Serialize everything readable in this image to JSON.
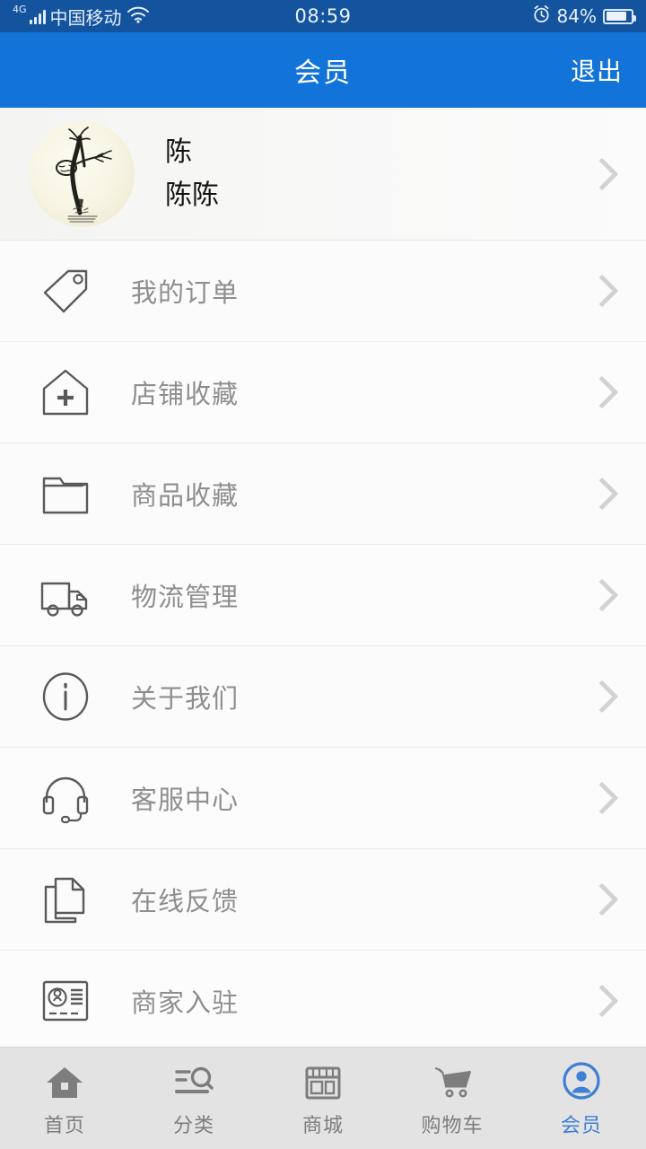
{
  "statusbar": {
    "network_type": "4G",
    "carrier": "中国移动",
    "wifi_icon": "wifi-icon",
    "time": "08:59",
    "alarm_icon": "alarm-clock-icon",
    "battery_percent": "84%",
    "battery_icon": "battery-icon"
  },
  "header": {
    "title": "会员",
    "action_label": "退出"
  },
  "profile": {
    "avatar_icon": "user-avatar-ink-painting",
    "name": "陈",
    "nickname": "陈陈",
    "chevron_icon": "chevron-right-icon"
  },
  "menu": {
    "items": [
      {
        "label": "我的订单",
        "icon": "price-tag-icon",
        "chevron": "chevron-right-icon"
      },
      {
        "label": "店铺收藏",
        "icon": "house-plus-icon",
        "chevron": "chevron-right-icon"
      },
      {
        "label": "商品收藏",
        "icon": "folder-icon",
        "chevron": "chevron-right-icon"
      },
      {
        "label": "物流管理",
        "icon": "truck-icon",
        "chevron": "chevron-right-icon"
      },
      {
        "label": "关于我们",
        "icon": "info-circle-icon",
        "chevron": "chevron-right-icon"
      },
      {
        "label": "客服中心",
        "icon": "headset-icon",
        "chevron": "chevron-right-icon"
      },
      {
        "label": "在线反馈",
        "icon": "documents-icon",
        "chevron": "chevron-right-icon"
      },
      {
        "label": "商家入驻",
        "icon": "id-card-icon",
        "chevron": "chevron-right-icon"
      }
    ]
  },
  "tabbar": {
    "items": [
      {
        "label": "首页",
        "icon": "home-icon",
        "active": false
      },
      {
        "label": "分类",
        "icon": "category-search-icon",
        "active": false
      },
      {
        "label": "商城",
        "icon": "storefront-icon",
        "active": false
      },
      {
        "label": "购物车",
        "icon": "shopping-cart-icon",
        "active": false
      },
      {
        "label": "会员",
        "icon": "user-circle-icon",
        "active": true
      }
    ]
  },
  "colors": {
    "statusbar_bg": "#14549f",
    "header_bg": "#1273d8",
    "accent": "#3f7fd4",
    "icon_gray": "#5a5a5a",
    "label_gray": "#8e8e8e",
    "tabbar_bg": "#e3e3e3"
  }
}
